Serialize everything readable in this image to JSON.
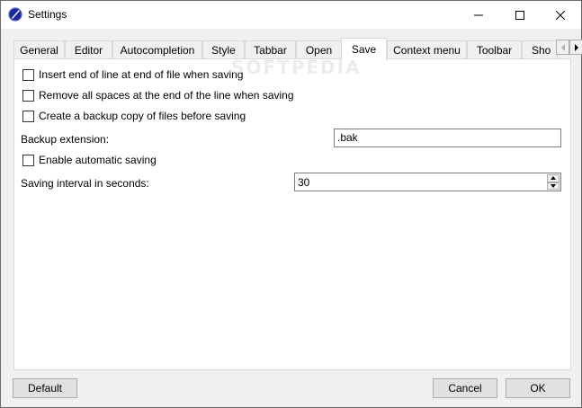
{
  "window": {
    "title": "Settings",
    "accent_color": "#2b3aa8"
  },
  "tabs": [
    {
      "label": "General"
    },
    {
      "label": "Editor"
    },
    {
      "label": "Autocompletion"
    },
    {
      "label": "Style"
    },
    {
      "label": "Tabbar"
    },
    {
      "label": "Open"
    },
    {
      "label": "Save",
      "active": true
    },
    {
      "label": "Context menu"
    },
    {
      "label": "Toolbar"
    },
    {
      "label": "Sho"
    }
  ],
  "save_page": {
    "options": [
      {
        "label": "Insert end of line at end of file when saving",
        "checked": false
      },
      {
        "label": "Remove all spaces at the end of the line when saving",
        "checked": false
      },
      {
        "label": "Create a backup copy of files before saving",
        "checked": false
      }
    ],
    "backup_extension": {
      "label": "Backup extension:",
      "value": ".bak"
    },
    "auto_save": {
      "label": "Enable automatic saving",
      "checked": false
    },
    "saving_interval": {
      "label": "Saving interval in seconds:",
      "value": "30"
    }
  },
  "watermark": "SOFTPEDIA",
  "buttons": {
    "default": "Default",
    "cancel": "Cancel",
    "ok": "OK"
  }
}
